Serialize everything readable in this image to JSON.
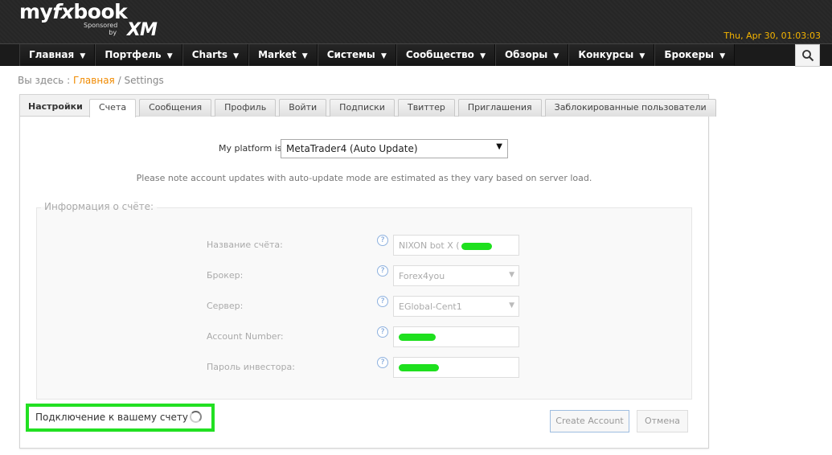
{
  "header": {
    "logo_prefix": "my",
    "logo_fx": "fx",
    "logo_suffix": "book",
    "sponsored": "Sponsored",
    "by": "by",
    "sponsor_logo": "XM",
    "datetime": "Thu, Apr 30, 01:03:03"
  },
  "nav": {
    "items": [
      {
        "label": "Главная"
      },
      {
        "label": "Портфель"
      },
      {
        "label": "Charts"
      },
      {
        "label": "Market"
      },
      {
        "label": "Системы"
      },
      {
        "label": "Сообщество"
      },
      {
        "label": "Обзоры"
      },
      {
        "label": "Конкурсы"
      },
      {
        "label": "Брокеры"
      }
    ],
    "caret": "▼",
    "search_icon": "search-icon"
  },
  "breadcrumb": {
    "prefix": "Вы здесь :",
    "home": "Главная",
    "separator": "/",
    "current": "Settings"
  },
  "panel": {
    "title": "Настройки",
    "tabs": [
      {
        "label": "Счета",
        "active": true
      },
      {
        "label": "Сообщения"
      },
      {
        "label": "Профиль"
      },
      {
        "label": "Войти"
      },
      {
        "label": "Подписки"
      },
      {
        "label": "Твиттер"
      },
      {
        "label": "Приглашения"
      },
      {
        "label": "Заблокированные пользователи"
      }
    ],
    "platform_label": "My platform is:",
    "platform_value": "MetaTrader4 (Auto Update)",
    "note": "Please note account updates with auto-update mode are estimated as they vary based on server load.",
    "fieldset_legend": "Информация о счёте:",
    "fields": {
      "account_name": {
        "label": "Название счёта:",
        "value": "NIXON bot X ("
      },
      "broker": {
        "label": "Брокер:",
        "value": "Forex4you"
      },
      "server": {
        "label": "Сервер:",
        "value": "EGlobal-Cent1"
      },
      "account_number": {
        "label": "Account Number:",
        "value": ""
      },
      "investor_password": {
        "label": "Пароль инвестора:",
        "value": ""
      }
    },
    "help_symbol": "?",
    "status_text": "Подключение к вашему счету",
    "create_button": "Create Account",
    "cancel_button": "Отмена"
  },
  "colors": {
    "accent_orange": "#f08a00",
    "datetime_yellow": "#f5b400",
    "highlight_green": "#22e022"
  }
}
